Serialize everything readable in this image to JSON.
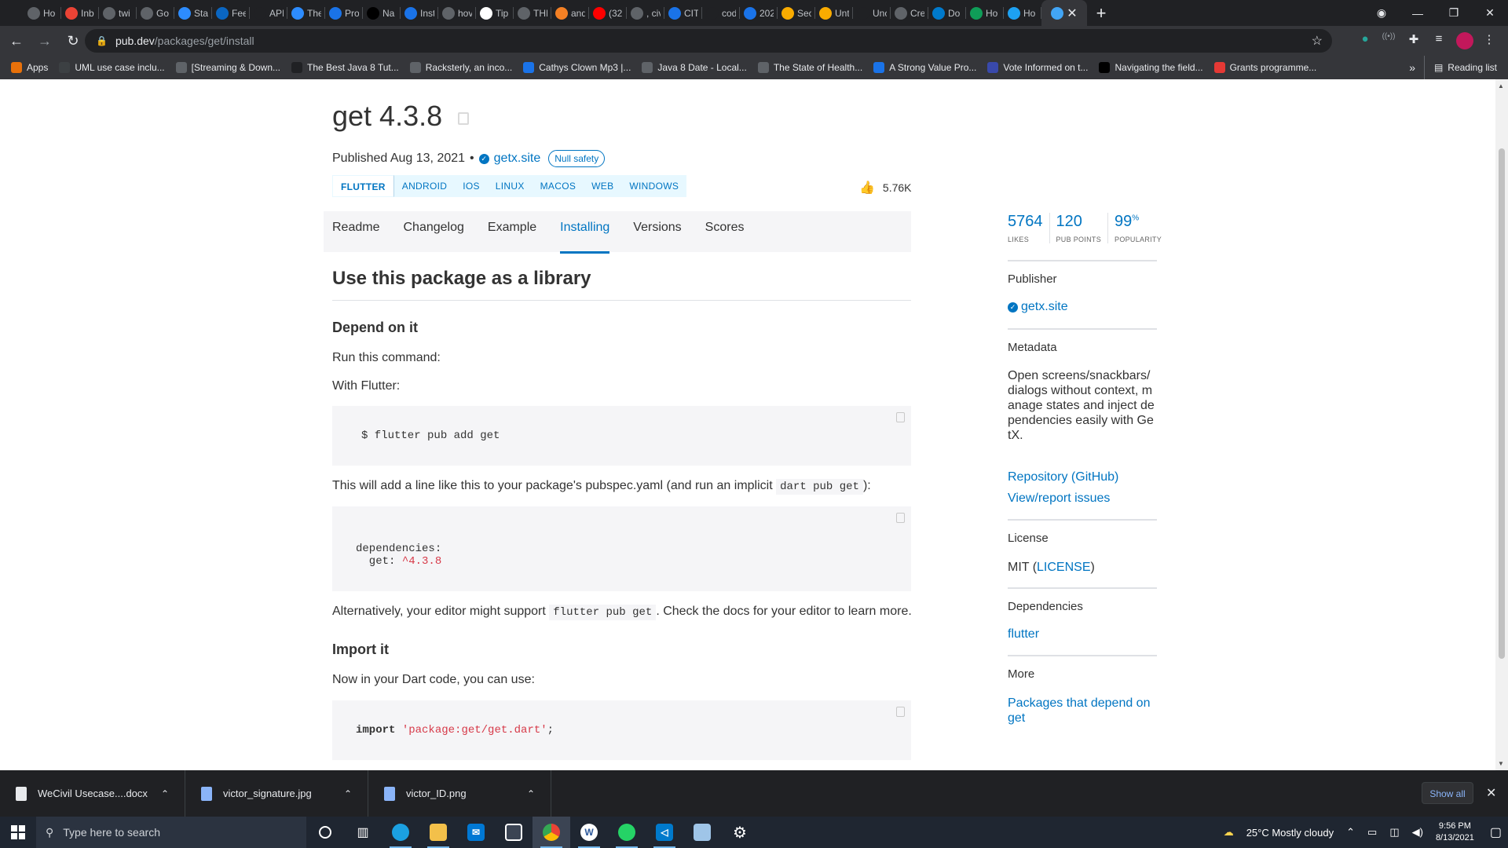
{
  "browser": {
    "tabs": [
      {
        "label": "Ho",
        "color": "#5f6368"
      },
      {
        "label": "Inb",
        "color": "#ea4335"
      },
      {
        "label": "twi",
        "color": "#5f6368"
      },
      {
        "label": "Go",
        "color": "#5f6368"
      },
      {
        "label": "Sta",
        "color": "#2d8cff"
      },
      {
        "label": "Fee",
        "color": "#0a66c2"
      },
      {
        "label": "API",
        "color": "#202124"
      },
      {
        "label": "The",
        "color": "#2d8cff"
      },
      {
        "label": "Pro",
        "color": "#1a73e8"
      },
      {
        "label": "Na",
        "color": "#000000"
      },
      {
        "label": "Inst",
        "color": "#1a73e8"
      },
      {
        "label": "hov",
        "color": "#5f6368"
      },
      {
        "label": "Tip",
        "color": "#ffffff"
      },
      {
        "label": "THI",
        "color": "#5f6368"
      },
      {
        "label": "and",
        "color": "#f48024"
      },
      {
        "label": "(32",
        "color": "#ff0000"
      },
      {
        "label": ", civ",
        "color": "#5f6368"
      },
      {
        "label": "CIT",
        "color": "#1a73e8"
      },
      {
        "label": "cod",
        "color": "#202124"
      },
      {
        "label": "202",
        "color": "#1a73e8"
      },
      {
        "label": "Sec",
        "color": "#f9ab00"
      },
      {
        "label": "Unt",
        "color": "#f9ab00"
      },
      {
        "label": "Unc",
        "color": "#202124"
      },
      {
        "label": "Cre",
        "color": "#5f6368"
      },
      {
        "label": "Do",
        "color": "#007acc"
      },
      {
        "label": "Ho",
        "color": "#0f9d58"
      },
      {
        "label": "Ho",
        "color": "#1da1f2"
      }
    ],
    "active_tab_color": "#42a5f5",
    "url_host": "pub.dev",
    "url_path": "/packages/get/install",
    "bookmarks": [
      {
        "label": "Apps",
        "color": "#e8710a"
      },
      {
        "label": "UML use case inclu...",
        "color": "#3c4043"
      },
      {
        "label": "[Streaming & Down...",
        "color": "#5f6368"
      },
      {
        "label": "The Best Java 8 Tut...",
        "color": "#202124"
      },
      {
        "label": "Racksterly, an inco...",
        "color": "#5f6368"
      },
      {
        "label": "Cathys Clown Mp3 |...",
        "color": "#1a73e8"
      },
      {
        "label": "Java 8 Date - Local...",
        "color": "#5f6368"
      },
      {
        "label": "The State of Health...",
        "color": "#5f6368"
      },
      {
        "label": "A Strong Value Pro...",
        "color": "#1a73e8"
      },
      {
        "label": "Vote Informed on t...",
        "color": "#3949ab"
      },
      {
        "label": "Navigating the field...",
        "color": "#000000"
      },
      {
        "label": "Grants programme...",
        "color": "#e53935"
      }
    ],
    "reading_list": "Reading list"
  },
  "package": {
    "title": "get 4.3.8",
    "published": "Published Aug 13, 2021",
    "bullet": "•",
    "publisher": "getx.site",
    "null_safety": "Null safety",
    "platforms": [
      "FLUTTER",
      "ANDROID",
      "IOS",
      "LINUX",
      "MACOS",
      "WEB",
      "WINDOWS"
    ],
    "likes_short": "5.76K"
  },
  "detail_tabs": [
    "Readme",
    "Changelog",
    "Example",
    "Installing",
    "Versions",
    "Scores"
  ],
  "active_detail_tab": "Installing",
  "install": {
    "section_title": "Use this package as a library",
    "depend_title": "Depend on it",
    "run_command": "Run this command:",
    "with_flutter": "With Flutter:",
    "cmd": "$ flutter pub add get",
    "pubspec_pre": "This will add a line like this to your package's pubspec.yaml (and run an implicit ",
    "pubspec_code": "dart pub get",
    "pubspec_post": "):",
    "deps_key": "dependencies:",
    "deps_get": "  get: ",
    "deps_version": "^4.3.8",
    "alt_pre": "Alternatively, your editor might support ",
    "alt_code": "flutter pub get",
    "alt_post": ". Check the docs for your editor to learn more.",
    "import_title": "Import it",
    "import_text": "Now in your Dart code, you can use:",
    "import_kw": "import",
    "import_str": "'package:get/get.dart'",
    "import_end": ";"
  },
  "sidebar": {
    "likes": "5764",
    "likes_label": "LIKES",
    "points": "120",
    "points_label": "PUB POINTS",
    "popularity": "99",
    "popularity_unit": "%",
    "popularity_label": "POPULARITY",
    "publisher_h": "Publisher",
    "publisher": "getx.site",
    "metadata_h": "Metadata",
    "metadata_text": "Open screens/snackbars/dialogs without context, manage states and inject dependencies easily with GetX.",
    "repo": "Repository (GitHub)",
    "issues": "View/report issues",
    "license_h": "License",
    "license_pre": "MIT (",
    "license_link": "LICENSE",
    "license_post": ")",
    "deps_h": "Dependencies",
    "dep": "flutter",
    "more_h": "More",
    "more_link": "Packages that depend on get"
  },
  "downloads": {
    "items": [
      "WeCivil Usecase....docx",
      "victor_signature.jpg",
      "victor_ID.png"
    ],
    "show_all": "Show all"
  },
  "taskbar": {
    "search_placeholder": "Type here to search",
    "weather": "25°C  Mostly cloudy",
    "time": "9:56 PM",
    "date": "8/13/2021"
  }
}
